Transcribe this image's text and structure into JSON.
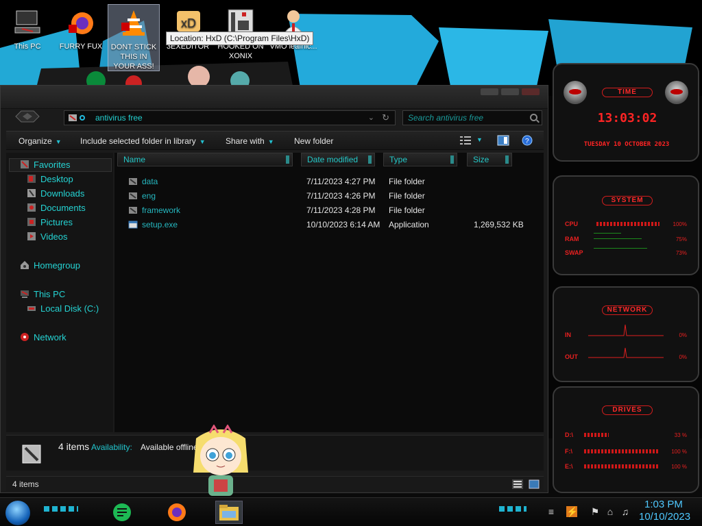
{
  "desktop": {
    "icons": [
      {
        "label": "This PC"
      },
      {
        "label": "FURRY FUX"
      },
      {
        "label": "DONT STICK THIS IN YOUR ASS!"
      },
      {
        "label": "3EXEDITOR"
      },
      {
        "label": "HOOKED ON XONIX"
      },
      {
        "label": "VMO leafnic..."
      }
    ],
    "tooltip": "Location: HxD (C:\\Program Files\\HxD)"
  },
  "explorer": {
    "address": "antivirus free",
    "search_placeholder": "Search antivirus free",
    "toolbar": {
      "organize": "Organize",
      "include_library": "Include selected folder in library",
      "share_with": "Share with",
      "new_folder": "New folder"
    },
    "nav": {
      "favorites": "Favorites",
      "desktop": "Desktop",
      "downloads": "Downloads",
      "documents": "Documents",
      "pictures": "Pictures",
      "videos": "Videos",
      "homegroup": "Homegroup",
      "this_pc": "This PC",
      "local_disk": "Local Disk (C:)",
      "network": "Network"
    },
    "columns": {
      "name": "Name",
      "date": "Date modified",
      "type": "Type",
      "size": "Size"
    },
    "files": [
      {
        "name": "data",
        "date": "7/11/2023 4:27 PM",
        "type": "File folder",
        "size": ""
      },
      {
        "name": "eng",
        "date": "7/11/2023 4:26 PM",
        "type": "File folder",
        "size": ""
      },
      {
        "name": "framework",
        "date": "7/11/2023 4:28 PM",
        "type": "File folder",
        "size": ""
      },
      {
        "name": "setup.exe",
        "date": "10/10/2023 6:14 AM",
        "type": "Application",
        "size": "1,269,532 KB"
      }
    ],
    "details": {
      "count": "4 items",
      "availability_label": "Availability:",
      "availability_value": "Available offline"
    },
    "status": {
      "count": "4 items"
    }
  },
  "gadgets": {
    "time": {
      "title": "TIME",
      "clock": "13:03:02",
      "date": "TUESDAY 10 OCTOBER 2023"
    },
    "system": {
      "title": "SYSTEM",
      "cpu_label": "CPU",
      "ram_label": "RAM",
      "swap_label": "SWAP",
      "cpu_value": "100%",
      "ram_value": "75%",
      "swap_value": "73%"
    },
    "network": {
      "title": "NETWORK",
      "in_label": "IN",
      "out_label": "OUT",
      "in_value": "0%",
      "out_value": "0%"
    },
    "drives": {
      "title": "DRIVES",
      "d1_label": "D:\\",
      "d2_label": "F:\\",
      "d3_label": "E:\\",
      "d1_value": "33 %",
      "d2_value": "100 %",
      "d3_value": "100 %"
    }
  },
  "taskbar": {
    "time": "1:03 PM",
    "date": "10/10/2023"
  },
  "colors": {
    "accent": "#23d0d0",
    "gadget_red": "#ff2424",
    "clock": "#4fc8ff"
  }
}
